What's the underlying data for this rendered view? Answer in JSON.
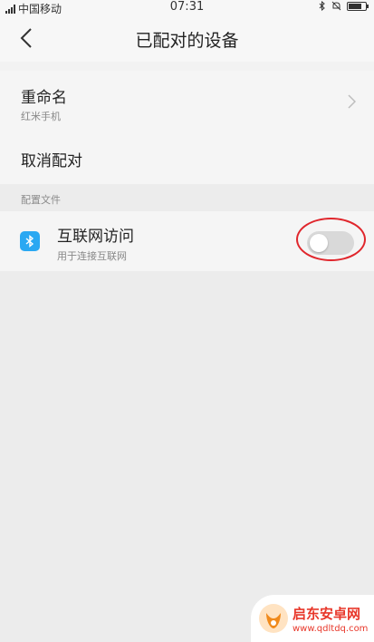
{
  "status_bar": {
    "carrier": "中国移动",
    "time": "07:31",
    "bluetooth_icon": "bluetooth-icon",
    "mute_icon": "bell-muted-icon",
    "battery_level": 0.8
  },
  "header": {
    "title": "已配对的设备",
    "back_icon": "chevron-left-icon"
  },
  "device_settings": {
    "rename_label": "重命名",
    "device_name": "红米手机",
    "unpair_label": "取消配对"
  },
  "profiles": {
    "section_label": "配置文件",
    "items": [
      {
        "label": "互联网访问",
        "description": "用于连接互联网",
        "icon": "bluetooth-icon",
        "enabled": false
      }
    ]
  },
  "watermark": {
    "title": "启东安卓网",
    "url": "www.qdltdq.com"
  },
  "colors": {
    "accent_blue": "#2aa8f2",
    "annotation_red": "#e0262c",
    "toggle_off": "#d9d9d9",
    "watermark_red": "#e8372a"
  }
}
